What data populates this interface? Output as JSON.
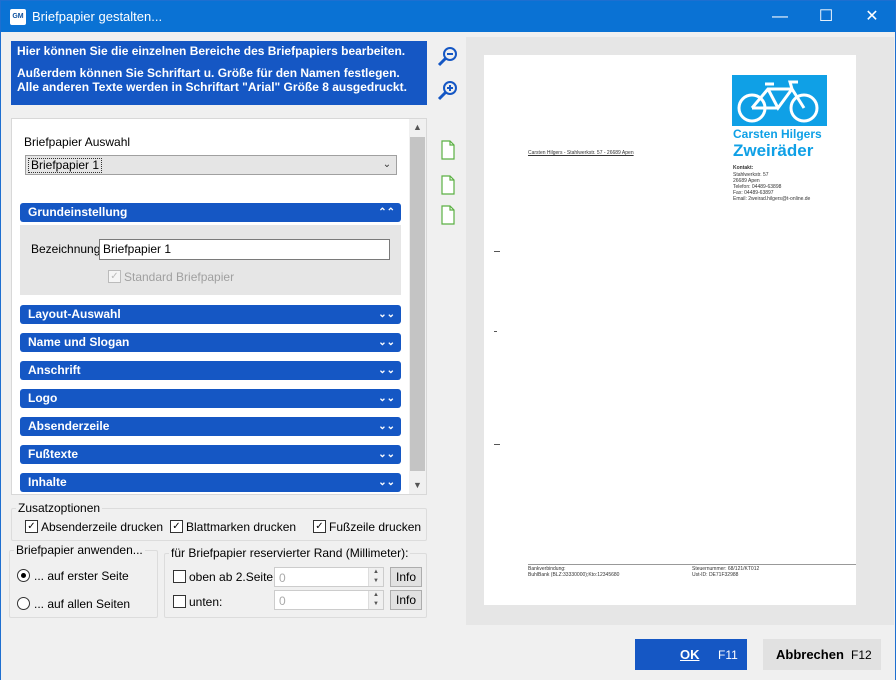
{
  "window": {
    "title": "Briefpapier gestalten...",
    "app_icon_text": "GM"
  },
  "info": {
    "line1": "Hier können Sie die einzelnen Bereiche des Briefpapiers bearbeiten.",
    "line2": "Außerdem können Sie Schriftart u. Größe für den Namen festlegen.",
    "line3": "Alle anderen Texte werden in Schriftart \"Arial\" Größe 8 ausgedruckt."
  },
  "auswahl": {
    "label": "Briefpapier Auswahl",
    "selected": "Briefpapier 1"
  },
  "grund": {
    "title": "Grundeinstellung",
    "bezeichnung_label": "Bezeichnung",
    "bezeichnung_value": "Briefpapier 1",
    "standard_label": "Standard Briefpapier",
    "standard_checked": true
  },
  "sections": [
    {
      "label": "Layout-Auswahl"
    },
    {
      "label": "Name und Slogan"
    },
    {
      "label": "Anschrift"
    },
    {
      "label": "Logo"
    },
    {
      "label": "Absenderzeile"
    },
    {
      "label": "Fußtexte"
    },
    {
      "label": "Inhalte"
    }
  ],
  "zusatz": {
    "legend": "Zusatzoptionen",
    "options": [
      {
        "label": "Absenderzeile drucken",
        "checked": true
      },
      {
        "label": "Blattmarken drucken",
        "checked": true
      },
      {
        "label": "Fußzeile drucken",
        "checked": true
      }
    ]
  },
  "anwenden": {
    "legend": "Briefpapier anwenden...",
    "options": [
      {
        "label": "... auf erster Seite",
        "selected": true
      },
      {
        "label": "... auf allen Seiten",
        "selected": false
      }
    ]
  },
  "rand": {
    "legend": "für Briefpapier reservierter Rand (Millimeter):",
    "oben_label": "oben ab 2.Seite:",
    "oben_value": "0",
    "unten_label": "unten:",
    "unten_value": "0",
    "info_label": "Info"
  },
  "preview": {
    "brand_name": "Carsten Hilgers",
    "brand_slogan": "Zweiräder",
    "sender_line": "Carsten Hilgers - Stahlwerkstr. 57 - 26689 Apen",
    "contact": [
      "Kontakt:",
      "Stahlwerkstr. 57",
      "26689 Apen",
      "Telefon: 04489-63898",
      "Fax: 04489-63897",
      "Email: 2weirad.hilgers@t-online.de"
    ],
    "footer_left": [
      "Bankverbindung:",
      "BuhlBank (BLZ:33330000);Kto:12345680"
    ],
    "footer_right": [
      "Steuernummer: 68/121/KT012",
      "Ust-ID: DE71F32988"
    ]
  },
  "buttons": {
    "ok": "OK",
    "ok_key": "F11",
    "cancel": "Abbrechen",
    "cancel_key": "F12"
  },
  "colors": {
    "titlebar": "#0a72d4",
    "section_bar": "#1557c4",
    "brand": "#0fa0e6"
  }
}
